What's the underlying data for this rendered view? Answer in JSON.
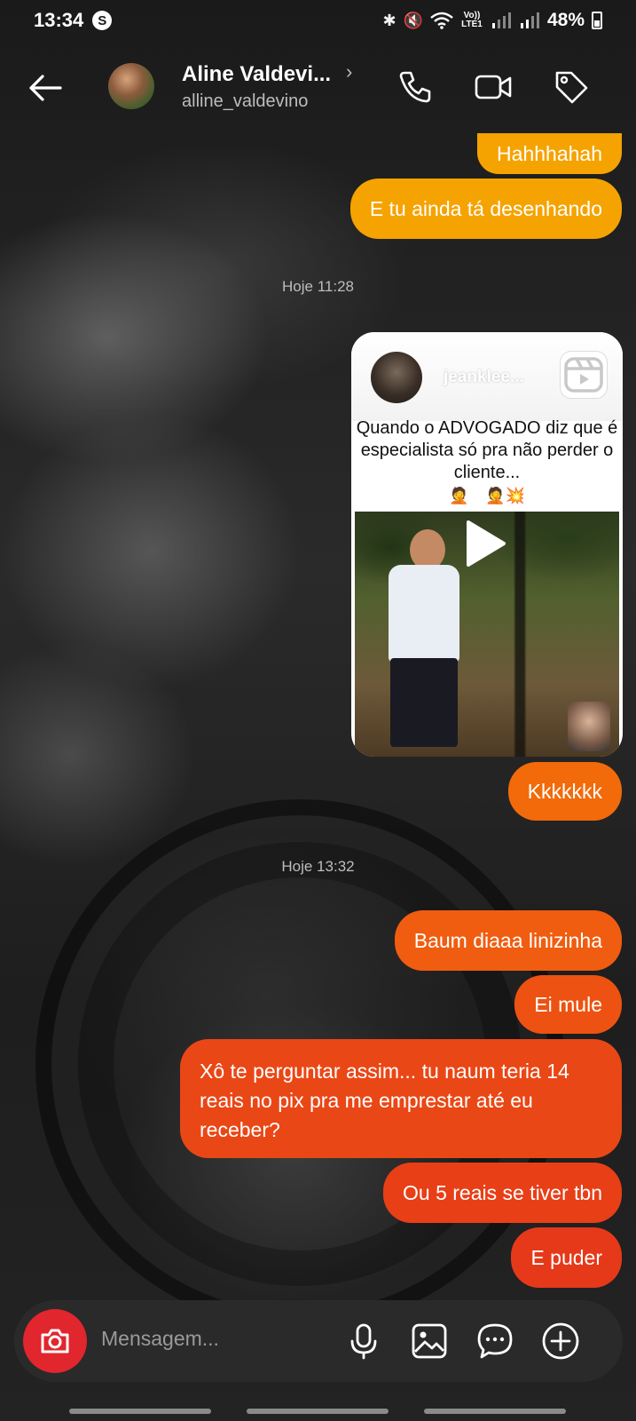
{
  "status_bar": {
    "time": "13:34",
    "app_badge": "S",
    "network_label": "Vo)) LTE1",
    "battery": "48%"
  },
  "header": {
    "name": "Aline Valdevi...",
    "username": "alline_valdevino",
    "icons": [
      "back-arrow-icon",
      "phone-icon",
      "video-camera-icon",
      "tag-icon"
    ]
  },
  "messages": [
    {
      "text": "Hahhhahah"
    },
    {
      "text": "E tu ainda tá desenhando"
    },
    {
      "text": "Kkkkkkk"
    },
    {
      "text": "Baum diaaa linizinha"
    },
    {
      "text": "Ei mule"
    },
    {
      "text": "Xô te perguntar assim... tu naum teria 14 reais no pix pra me emprestar até eu receber?"
    },
    {
      "text": "Ou 5 reais se tiver tbn"
    },
    {
      "text": "E puder"
    }
  ],
  "timestamps": [
    "Hoje 11:28",
    "Hoje 13:32"
  ],
  "shared_reel": {
    "author": "jeanklee...",
    "caption": "Quando o ADVOGADO diz que é especialista só pra não perder o cliente...",
    "emojis": "🤦😅🤦💥"
  },
  "composer": {
    "placeholder": "Mensagem...",
    "icons": [
      "camera-icon",
      "microphone-icon",
      "gallery-icon",
      "sticker-icon",
      "plus-icon"
    ]
  },
  "colors": {
    "bubble_yellow": "#f5a300",
    "bubble_orange": "#f26a0a",
    "bubble_red": "#e8391a",
    "camera_red": "#e1262d"
  }
}
